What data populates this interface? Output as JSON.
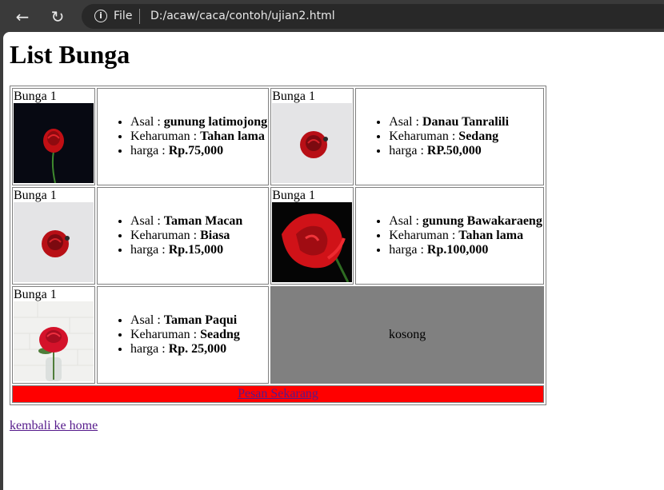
{
  "browser": {
    "scheme_label": "File",
    "url": "D:/acaw/caca/contoh/ujian2.html"
  },
  "page": {
    "title": "List Bunga",
    "empty_cell": "kosong",
    "order_link": "Pesan Sekarang",
    "home_link": "kembali ke home"
  },
  "labels": {
    "origin": "Asal : ",
    "scent": "Keharuman : ",
    "price": "harga : "
  },
  "flowers": [
    {
      "caption": "Bunga 1",
      "origin": "gunung latimojong",
      "scent": "Tahan lama",
      "price": "Rp.75,000"
    },
    {
      "caption": "Bunga 1",
      "origin": "Danau Tanralili",
      "scent": "Sedang",
      "price": "RP.50,000"
    },
    {
      "caption": "Bunga 1",
      "origin": "Taman Macan",
      "scent": "Biasa",
      "price": "Rp.15,000"
    },
    {
      "caption": "Bunga 1",
      "origin": "gunung Bawakaraeng",
      "scent": "Tahan lama",
      "price": "Rp.100,000"
    },
    {
      "caption": "Bunga 1",
      "origin": "Taman Paqui",
      "scent": "Seadng",
      "price": "Rp. 25,000"
    }
  ]
}
